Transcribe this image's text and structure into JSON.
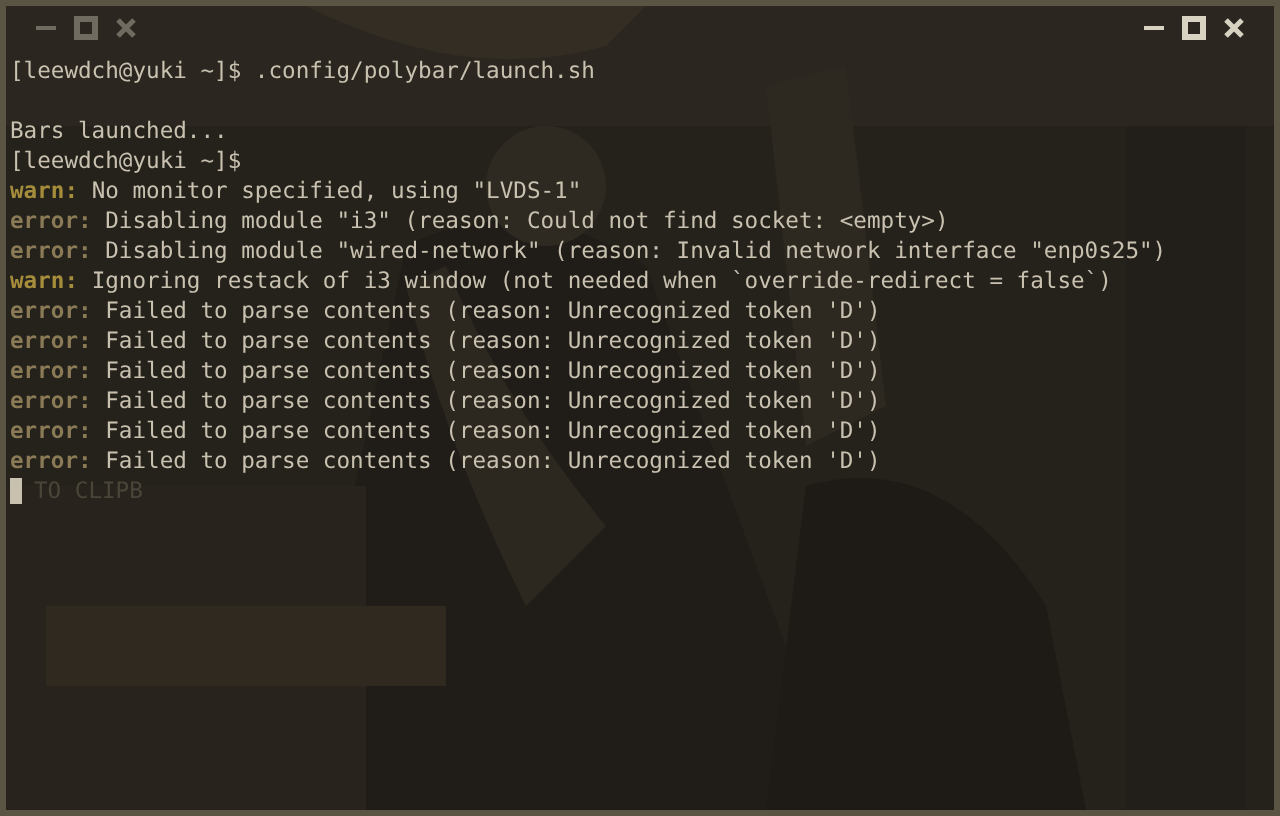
{
  "window": {
    "left_controls": [
      {
        "kind": "minimize"
      },
      {
        "kind": "maximize"
      },
      {
        "kind": "close"
      }
    ],
    "right_controls": [
      {
        "kind": "minimize"
      },
      {
        "kind": "maximize"
      },
      {
        "kind": "close"
      }
    ]
  },
  "terminal": {
    "lines": [
      {
        "kind": "plain",
        "text": "[leewdch@yuki ~]$ .config/polybar/launch.sh"
      },
      {
        "kind": "blank"
      },
      {
        "kind": "plain",
        "text": "Bars launched..."
      },
      {
        "kind": "plain",
        "text": "[leewdch@yuki ~]$"
      },
      {
        "kind": "warn",
        "label": "warn:",
        "text": "No monitor specified, using \"LVDS-1\""
      },
      {
        "kind": "error",
        "label": "error:",
        "text": "Disabling module \"i3\" (reason: Could not find socket: <empty>)"
      },
      {
        "kind": "error",
        "label": "error:",
        "text": "Disabling module \"wired-network\" (reason: Invalid network interface \"enp0s25\")"
      },
      {
        "kind": "warn",
        "label": "warn:",
        "text": "Ignoring restack of i3 window (not needed when `override-redirect = false`)"
      },
      {
        "kind": "error",
        "label": "error:",
        "text": "Failed to parse contents (reason: Unrecognized token 'D')"
      },
      {
        "kind": "error",
        "label": "error:",
        "text": "Failed to parse contents (reason: Unrecognized token 'D')"
      },
      {
        "kind": "error",
        "label": "error:",
        "text": "Failed to parse contents (reason: Unrecognized token 'D')"
      },
      {
        "kind": "error",
        "label": "error:",
        "text": "Failed to parse contents (reason: Unrecognized token 'D')"
      },
      {
        "kind": "error",
        "label": "error:",
        "text": "Failed to parse contents (reason: Unrecognized token 'D')"
      },
      {
        "kind": "error",
        "label": "error:",
        "text": "Failed to parse contents (reason: Unrecognized token 'D')"
      }
    ],
    "cursor_line": {
      "ghost_text": "TO CLIPB"
    }
  }
}
